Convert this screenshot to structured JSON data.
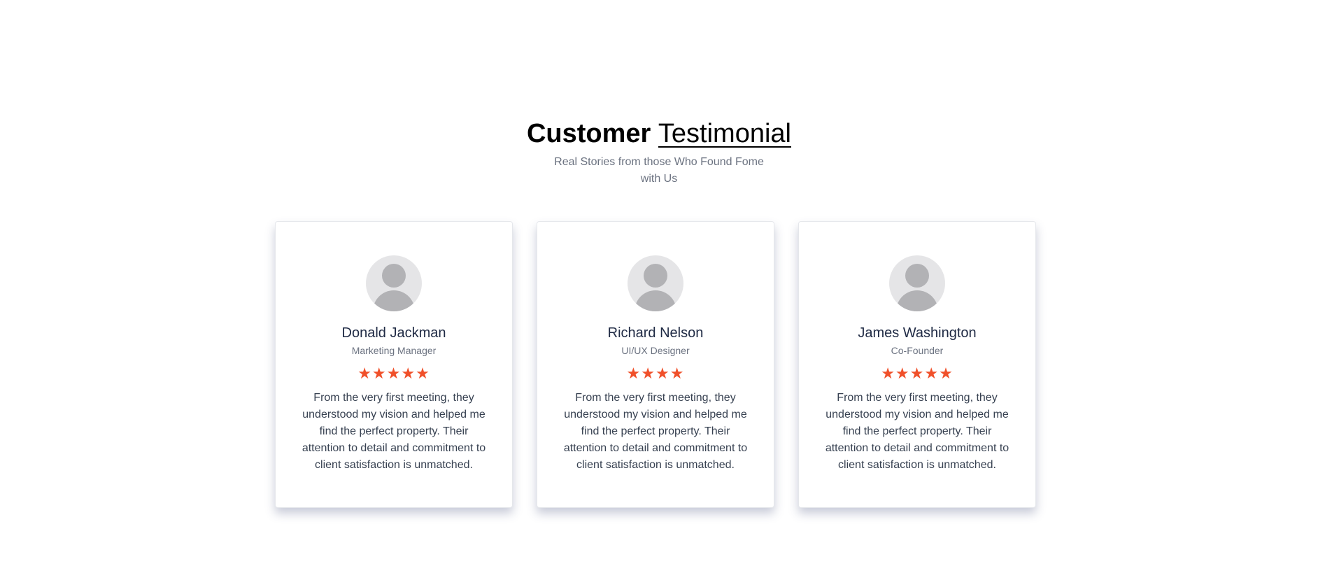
{
  "heading": {
    "bold": "Customer",
    "light": "Testimonial"
  },
  "subtitle": "Real Stories from those Who Found Fome with Us",
  "colors": {
    "star": "#f0502a",
    "avatar_bg": "#e5e5e7",
    "avatar_figure": "#b2b2b5"
  },
  "testimonials": [
    {
      "name": "Donald Jackman",
      "role": "Marketing Manager",
      "rating": 5,
      "stars": "★★★★★",
      "avatar_icon": "user-placeholder-icon",
      "quote": "From the very first meeting, they understood my vision and helped me find the perfect property. Their attention to detail and commitment to client satisfaction is unmatched."
    },
    {
      "name": "Richard Nelson",
      "role": "UI/UX Designer",
      "rating": 4,
      "stars": "★★★★",
      "avatar_icon": "user-placeholder-icon",
      "quote": "From the very first meeting, they understood my vision and helped me find the perfect property. Their attention to detail and commitment to client satisfaction is unmatched."
    },
    {
      "name": "James Washington",
      "role": "Co-Founder",
      "rating": 5,
      "stars": "★★★★★",
      "avatar_icon": "user-placeholder-icon",
      "quote": "From the very first meeting, they understood my vision and helped me find the perfect property. Their attention to detail and commitment to client satisfaction is unmatched."
    }
  ]
}
